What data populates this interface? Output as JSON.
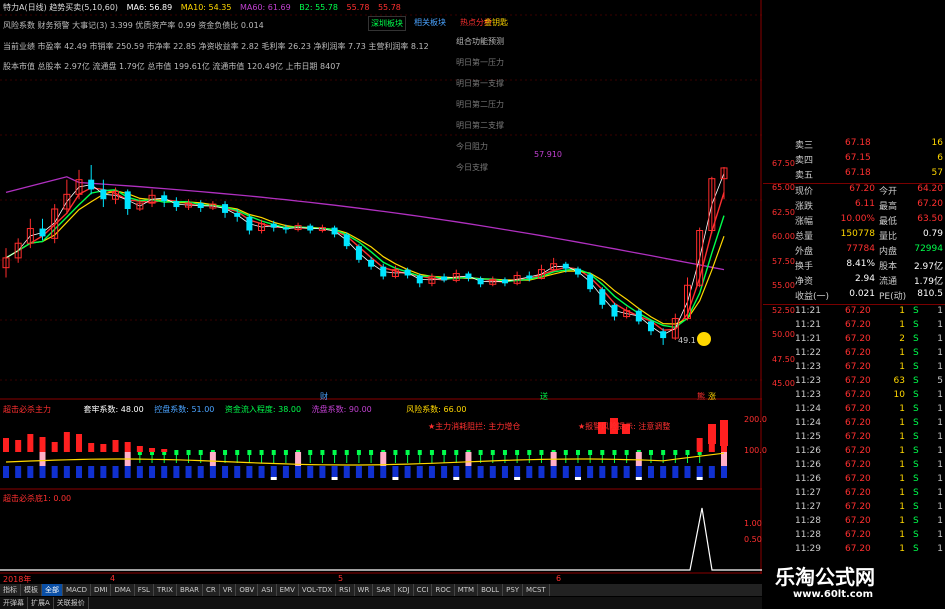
{
  "header": {
    "title": "特力A(日线) 趋势买卖(5,10,60)",
    "ma6": "MA6: 56.89",
    "ma10": "MA10: 54.35",
    "ma60": "MA60: 61.69",
    "b2": "B2: 55.78",
    "b3": "55.78",
    "b4": "55.78"
  },
  "buttons": {
    "deep_board": "深圳板块",
    "related": "相关板块",
    "hot": "热点分析",
    "notes": "金钥匙"
  },
  "info_lines": [
    "风险系数  财务预警  大事记(3)  3.399 优质资产率  0.99 资金负债比  0.014",
    "当前业绩  市盈率  42.49 市销率  250.59 市净率  22.85 净资收益率  2.82 毛利率  26.23 净利润率  7.73 主营利润率  8.12",
    "股本市值  总股本  2.97亿 流通盘  1.79亿 总市值  199.61亿 流通市值  120.49亿 上市日期  8407"
  ],
  "menu": {
    "title": "组合功能预测",
    "items": [
      "明日第一压力",
      "明日第一支撑",
      "明日第二压力",
      "明日第二支撑",
      "今日阻力",
      "今日支撑"
    ]
  },
  "price_axis": [
    "67.50",
    "65.00",
    "62.50",
    "60.00",
    "57.50",
    "55.00",
    "52.50",
    "50.00",
    "47.50",
    "45.00"
  ],
  "annotations": {
    "ma_value": "57.910",
    "low_price": "49.1",
    "marker_cai": "财",
    "marker_song": "送",
    "marker_xiong": "熊",
    "marker_tiao": "涨"
  },
  "indicator1": {
    "title": "超击必杀主力",
    "l1": "套牢系数: 48.00",
    "l2": "控盘系数: 51.00",
    "l3": "资金流入程度: 38.00",
    "l4": "洗盘系数: 90.00",
    "l5": "风险系数: 66.00",
    "note1": "★主力消耗阻拦: 主力增仓",
    "note2": "★报警风险提示: 注意调整",
    "axis": [
      "200.0",
      "100.0"
    ]
  },
  "indicator2": {
    "title": "超击必杀底1: 0.00",
    "axis": [
      "1.00",
      "0.50"
    ]
  },
  "time_axis": [
    "2018年",
    "4",
    "5",
    "6"
  ],
  "quote": {
    "ask": [
      {
        "label": "卖三",
        "price": "67.18",
        "vol": "16"
      },
      {
        "label": "卖四",
        "price": "67.15",
        "vol": "6"
      },
      {
        "label": "卖五",
        "price": "67.18",
        "vol": "57"
      }
    ],
    "stats": [
      {
        "l1": "现价",
        "v1": "67.20",
        "l2": "今开",
        "v2": "64.20"
      },
      {
        "l1": "涨跌",
        "v1": "6.11",
        "l2": "最高",
        "v2": "67.20"
      },
      {
        "l1": "涨幅",
        "v1": "10.00%",
        "l2": "最低",
        "v2": "63.50"
      },
      {
        "l1": "总量",
        "v1": "150778",
        "l2": "量比",
        "v2": "0.79"
      },
      {
        "l1": "外盘",
        "v1": "77784",
        "l2": "内盘",
        "v2": "72994"
      },
      {
        "l1": "换手",
        "v1": "8.41%",
        "l2": "股本",
        "v2": "2.97亿"
      },
      {
        "l1": "净资",
        "v1": "2.94",
        "l2": "流通",
        "v2": "1.79亿"
      },
      {
        "l1": "收益(一)",
        "v1": "0.021",
        "l2": "PE(动)",
        "v2": "810.5"
      }
    ],
    "ticks": [
      {
        "t": "11:21",
        "p": "67.20",
        "v": "1",
        "s": "S",
        "n": "1"
      },
      {
        "t": "11:21",
        "p": "67.20",
        "v": "1",
        "s": "S",
        "n": "1"
      },
      {
        "t": "11:21",
        "p": "67.20",
        "v": "2",
        "s": "S",
        "n": "1"
      },
      {
        "t": "11:22",
        "p": "67.20",
        "v": "1",
        "s": "S",
        "n": "1"
      },
      {
        "t": "11:23",
        "p": "67.20",
        "v": "1",
        "s": "S",
        "n": "1"
      },
      {
        "t": "11:23",
        "p": "67.20",
        "v": "63",
        "s": "S",
        "n": "5"
      },
      {
        "t": "11:23",
        "p": "67.20",
        "v": "10",
        "s": "S",
        "n": "1"
      },
      {
        "t": "11:24",
        "p": "67.20",
        "v": "1",
        "s": "S",
        "n": "1"
      },
      {
        "t": "11:24",
        "p": "67.20",
        "v": "1",
        "s": "S",
        "n": "1"
      },
      {
        "t": "11:25",
        "p": "67.20",
        "v": "1",
        "s": "S",
        "n": "1"
      },
      {
        "t": "11:26",
        "p": "67.20",
        "v": "1",
        "s": "S",
        "n": "1"
      },
      {
        "t": "11:26",
        "p": "67.20",
        "v": "1",
        "s": "S",
        "n": "1"
      },
      {
        "t": "11:26",
        "p": "67.20",
        "v": "1",
        "s": "S",
        "n": "1"
      },
      {
        "t": "11:27",
        "p": "67.20",
        "v": "1",
        "s": "S",
        "n": "1"
      },
      {
        "t": "11:27",
        "p": "67.20",
        "v": "1",
        "s": "S",
        "n": "1"
      },
      {
        "t": "11:28",
        "p": "67.20",
        "v": "1",
        "s": "S",
        "n": "1"
      },
      {
        "t": "11:28",
        "p": "67.20",
        "v": "1",
        "s": "S",
        "n": "1"
      },
      {
        "t": "11:29",
        "p": "67.20",
        "v": "1",
        "s": "S",
        "n": "1"
      }
    ]
  },
  "tabs": [
    "指标",
    "模板",
    "全部",
    "MACD",
    "DMI",
    "DMA",
    "FSL",
    "TRIX",
    "BRAR",
    "CR",
    "VR",
    "OBV",
    "ASI",
    "EMV",
    "VOL-TDX",
    "RSI",
    "WR",
    "SAR",
    "KDJ",
    "CCI",
    "ROC",
    "MTM",
    "BOLL",
    "PSY",
    "MCST"
  ],
  "active_tab": "全部",
  "tabs2": [
    "开弹幕",
    "扩展A",
    "关联报价"
  ],
  "logo": {
    "title": "乐淘公式网",
    "url": "www.60lt.com"
  },
  "colors": {
    "up": "#ff2d2d",
    "down": "#00e5ff",
    "ma_white": "#ffffff",
    "ma_yellow": "#ffd700",
    "ma_purple": "#b030c0",
    "green": "#00ff4c",
    "red_line": "#ff3030"
  }
}
